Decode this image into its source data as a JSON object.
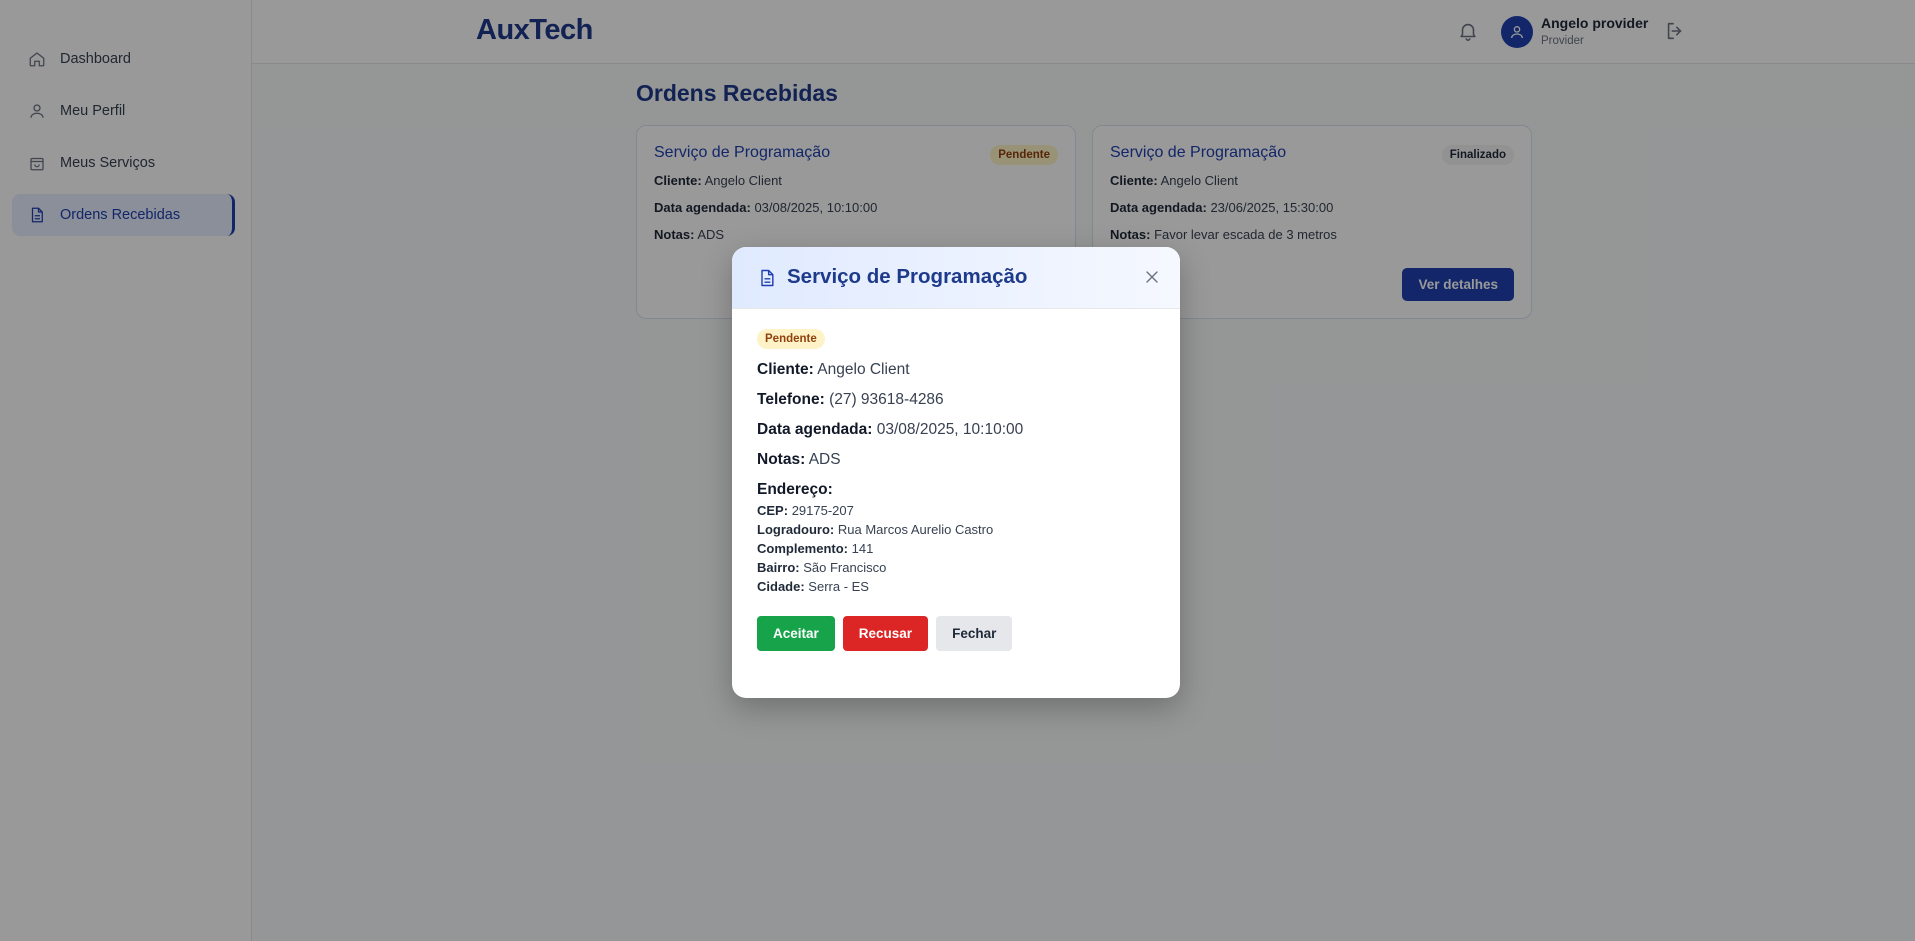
{
  "sidebar": {
    "items": [
      {
        "label": "Dashboard",
        "icon": "home-icon"
      },
      {
        "label": "Meu Perfil",
        "icon": "user-icon"
      },
      {
        "label": "Meus Serviços",
        "icon": "bag-icon"
      },
      {
        "label": "Ordens Recebidas",
        "icon": "document-icon",
        "active": true
      }
    ]
  },
  "header": {
    "logo": "AuxTech",
    "user_name": "Angelo provider",
    "user_role": "Provider"
  },
  "main": {
    "title": "Ordens Recebidas",
    "cards": [
      {
        "title": "Serviço de Programação",
        "status": "Pendente",
        "client_label": "Cliente:",
        "client": "Angelo Client",
        "date_label": "Data agendada:",
        "date": "03/08/2025, 10:10:00",
        "notes_label": "Notas:",
        "notes": "ADS"
      },
      {
        "title": "Serviço de Programação",
        "status": "Finalizado",
        "client_label": "Cliente:",
        "client": "Angelo Client",
        "date_label": "Data agendada:",
        "date": "23/06/2025, 15:30:00",
        "notes_label": "Notas:",
        "notes": "Favor levar escada de 3 metros",
        "details_button": "Ver detalhes"
      }
    ]
  },
  "modal": {
    "title": "Serviço de Programação",
    "status": "Pendente",
    "client_label": "Cliente:",
    "client": "Angelo Client",
    "phone_label": "Telefone:",
    "phone": "(27) 93618-4286",
    "date_label": "Data agendada:",
    "date": "03/08/2025, 10:10:00",
    "notes_label": "Notas:",
    "notes": "ADS",
    "address_title": "Endereço:",
    "address": {
      "cep_label": "CEP:",
      "cep": "29175-207",
      "street_label": "Logradouro:",
      "street": "Rua Marcos Aurelio Castro",
      "complement_label": "Complemento:",
      "complement": "141",
      "district_label": "Bairro:",
      "district": "São Francisco",
      "city_label": "Cidade:",
      "city": "Serra - ES"
    },
    "accept_label": "Aceitar",
    "reject_label": "Recusar",
    "close_label": "Fechar"
  },
  "colors": {
    "brand": "#1e3a8a",
    "accent": "#1e40af",
    "accept": "#16a34a",
    "reject": "#dc2626",
    "pending_bg": "#fef3c7"
  }
}
